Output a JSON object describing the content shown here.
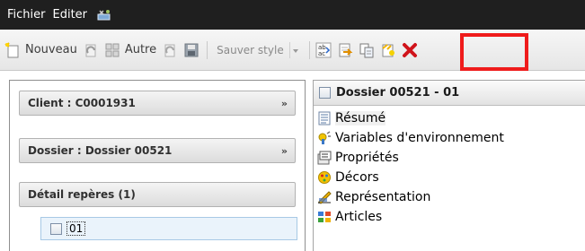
{
  "menu": {
    "items": [
      "Fichier",
      "Editer"
    ],
    "extra_icon": "toolbar-options-icon"
  },
  "toolbar": {
    "new_label": "Nouveau",
    "other_label": "Autre",
    "style_combo_label": "Sauver style",
    "icons": [
      "new-document-icon",
      "refresh-icon",
      "grid-icon",
      "refresh-disabled-icon",
      "save-icon",
      "format-text-icon",
      "import-document-icon",
      "copy-document-icon",
      "paste-document-icon",
      "delete-icon"
    ],
    "highlight_color": "#ef1b1b"
  },
  "left_panel": {
    "client_header": "Client : C0001931",
    "dossier_header": "Dossier : Dossier 00521",
    "detail_header": "Détail repères (1)",
    "detail_item": "01"
  },
  "right_panel": {
    "title": "Dossier 00521 - 01",
    "tree_items": [
      {
        "label": "Résumé",
        "icon": "summary-icon"
      },
      {
        "label": "Variables d'environnement",
        "icon": "environment-variables-icon"
      },
      {
        "label": "Propriétés",
        "icon": "properties-icon"
      },
      {
        "label": "Décors",
        "icon": "decors-icon"
      },
      {
        "label": "Représentation",
        "icon": "representation-icon"
      },
      {
        "label": "Articles",
        "icon": "articles-icon"
      }
    ]
  },
  "colors": {
    "menubar_bg": "#1f1f1f",
    "selection_bg": "#eaf3fb",
    "selection_border": "#a7c9e5"
  }
}
